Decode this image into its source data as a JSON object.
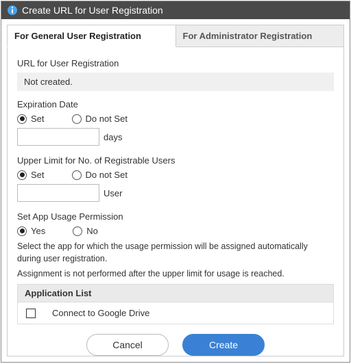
{
  "title": "Create URL for User Registration",
  "tabs": {
    "general": "For General User Registration",
    "admin": "For Administrator Registration"
  },
  "url_section": {
    "label": "URL for User Registration",
    "status": "Not created."
  },
  "expiration": {
    "label": "Expiration Date",
    "set": "Set",
    "donotset": "Do not Set",
    "unit": "days"
  },
  "upperlimit": {
    "label": "Upper Limit for No. of Registrable Users",
    "set": "Set",
    "donotset": "Do not Set",
    "unit": "User"
  },
  "permission": {
    "label": "Set App Usage Permission",
    "yes": "Yes",
    "no": "No",
    "help1": "Select the app for which the usage permission will be assigned automatically during user registration.",
    "help2": "Assignment is not performed after the upper limit for usage is reached."
  },
  "applist": {
    "header": "Application List",
    "items": [
      "Connect to Google Drive"
    ]
  },
  "buttons": {
    "cancel": "Cancel",
    "create": "Create"
  }
}
